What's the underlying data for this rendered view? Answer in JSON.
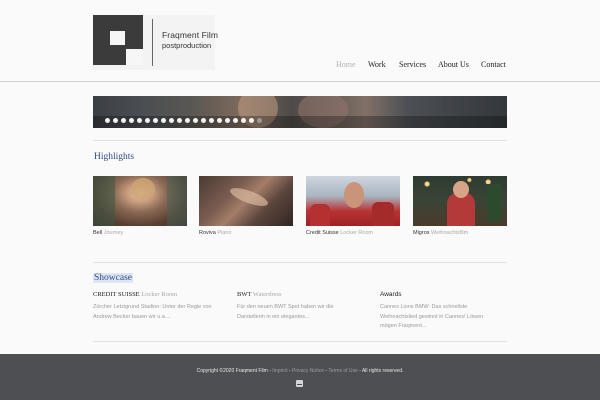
{
  "brand": {
    "name": "Fraqment Film",
    "sub": "postproduction",
    "colors": {
      "accent": "#2f4a86",
      "footer": "#4e4f52",
      "logo": "#3b3b3b"
    }
  },
  "nav": {
    "items": [
      {
        "label": "Home",
        "active": true
      },
      {
        "label": "Work",
        "active": false
      },
      {
        "label": "Services",
        "active": false
      },
      {
        "label": "About Us",
        "active": false
      },
      {
        "label": "Contact",
        "active": false
      }
    ]
  },
  "slider": {
    "dot_count": 20,
    "active_index": 19
  },
  "highlights": {
    "title": "Highlights",
    "items": [
      {
        "client": "Bell",
        "sub": "Journey"
      },
      {
        "client": "Roviva",
        "sub": "Piano"
      },
      {
        "client": "Credit Suisse",
        "sub": "Locker Room"
      },
      {
        "client": "Migros",
        "sub": "Weihnachtsfilm"
      }
    ]
  },
  "showcase": {
    "title": "Showcase",
    "columns": [
      {
        "title": "CREDIT SUISSE",
        "sub": "Locker Room",
        "line1": "Zürcher Letzigrund Stadion: Unter der Regie von",
        "line2": "Andrew Becker bauen wir u.a...."
      },
      {
        "title": "BWT",
        "sub": "Waterdress",
        "line1": "Für den neuen BWT Spot haben wir die",
        "line2": "Darstellerin in ein elegantes..."
      },
      {
        "title": "Awards",
        "sub": "",
        "line1": "Cannes Lions BMW: Das schnellste",
        "line2": "Weihnachtslied gewinnt in Cannes! Löwen",
        "line3": "mögen Fraqment..."
      }
    ]
  },
  "footer": {
    "copyright": "Copyright ©2020 Fraqment Film",
    "sep": " - ",
    "imprint": "Imprint",
    "privacy": "Privacy Notice",
    "terms": "Terms of Use",
    "rights": "All rights reserved.",
    "icon": "mail-icon"
  }
}
